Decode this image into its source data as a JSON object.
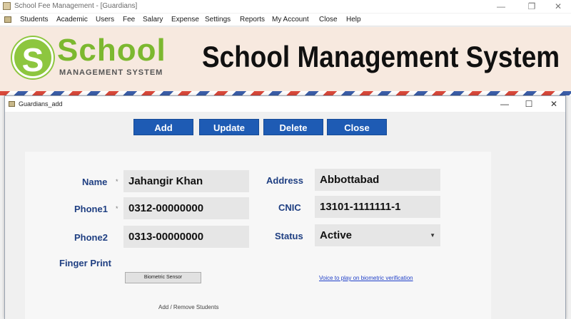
{
  "window": {
    "title": "School Fee Management - [Guardians]",
    "controls": {
      "minimize": "—",
      "restore": "❐",
      "close": "✕"
    }
  },
  "menu": {
    "items": [
      "Students",
      "Academic",
      "Users",
      "Fee",
      "Salary",
      "Expense",
      "Settings",
      "Reports",
      "My Account",
      "Close",
      "Help"
    ]
  },
  "banner": {
    "logo_letter": "S",
    "logo_word": "School",
    "logo_sub": "MANAGEMENT SYSTEM",
    "heading": "School Management System"
  },
  "dialog": {
    "title": "Guardians_add",
    "controls": {
      "minimize": "—",
      "maximize": "☐",
      "close": "✕"
    },
    "buttons": {
      "add": "Add",
      "update": "Update",
      "delete": "Delete",
      "close": "Close"
    },
    "form": {
      "name_label": "Name",
      "name_value": "Jahangir Khan",
      "phone1_label": "Phone1",
      "phone1_value": "0312-00000000",
      "phone2_label": "Phone2",
      "phone2_value": "0313-00000000",
      "address_label": "Address",
      "address_value": "Abbottabad",
      "cnic_label": "CNIC",
      "cnic_value": "13101-1111111-1",
      "status_label": "Status",
      "status_value": "Active",
      "required_mark": "*",
      "finger_label": "Finger Print",
      "biometric_button": "Biometric Sensor",
      "voice_link": "Voice to play on biometric verification",
      "students_link": "Add / Remove Students"
    }
  },
  "colors": {
    "accent_button": "#1e5bb4",
    "label": "#1f3f82",
    "logo_green": "#8dc63f",
    "banner_bg": "#f7e9df"
  }
}
